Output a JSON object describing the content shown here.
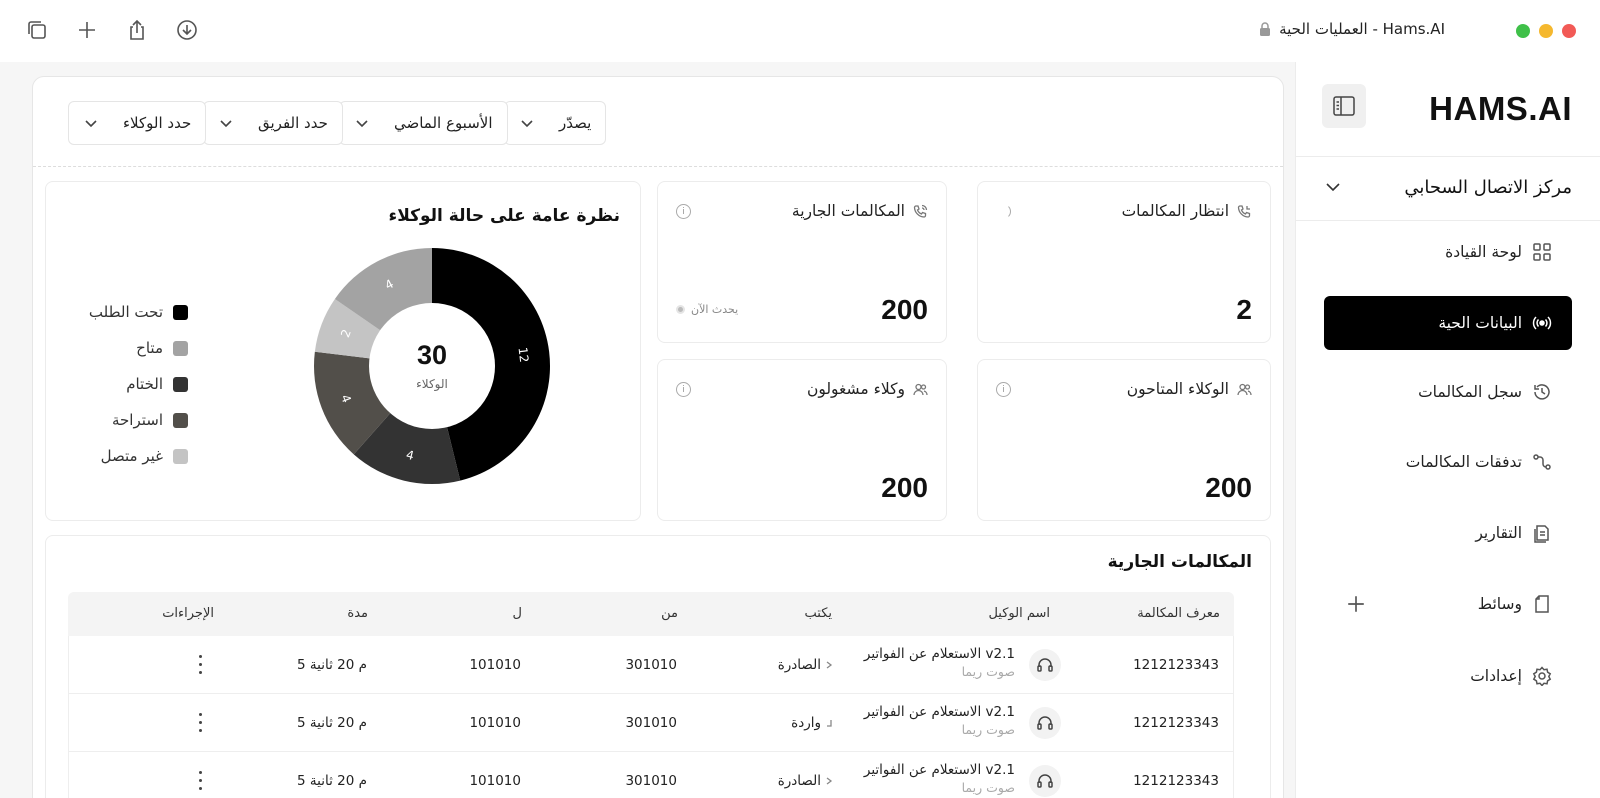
{
  "window": {
    "title": "العمليات الحية - Hams.AI"
  },
  "sidebar": {
    "logo": "HAMS.AI",
    "workspace": "مركز الاتصال السحابي",
    "items": [
      {
        "label": "لوحة القيادة",
        "icon": "grid-icon"
      },
      {
        "label": "البيانات الحية",
        "icon": "broadcast-icon",
        "active": true
      },
      {
        "label": "سجل المكالمات",
        "icon": "history-icon"
      },
      {
        "label": "تدفقات المكالمات",
        "icon": "flow-icon"
      },
      {
        "label": "التقارير",
        "icon": "reports-icon"
      },
      {
        "label": "وسائط",
        "icon": "media-icon"
      },
      {
        "label": "إعدادات",
        "icon": "gear-icon"
      }
    ]
  },
  "filters": {
    "export": "يصدّر",
    "period": "الأسبوع الماضي",
    "team": "حدد الفريق",
    "agents": "حدد الوكلاء"
  },
  "stats": {
    "waiting": {
      "title": "انتظار المكالمات",
      "value": "2"
    },
    "ongoing": {
      "title": "المكالمات الجارية",
      "value": "200",
      "live": "يحدث الآن"
    },
    "available": {
      "title": "الوكلاء المتاحون",
      "value": "200"
    },
    "busy": {
      "title": "وكلاء مشغولون",
      "value": "200"
    }
  },
  "chart_data": {
    "type": "pie",
    "title": "نظرة عامة على حالة الوكلاء",
    "center_value": "30",
    "center_label": "الوكلاء",
    "slices": [
      {
        "name": "تحت الطلب",
        "value": 12,
        "color": "#000000"
      },
      {
        "name": "الختام",
        "value": 4,
        "color": "#333333"
      },
      {
        "name": "استراحة",
        "value": 4,
        "color": "#524f4a"
      },
      {
        "name": "غير متصل",
        "value": 2,
        "color": "#c4c4c4"
      },
      {
        "name": "متاح",
        "value": 4,
        "color": "#a3a3a3"
      }
    ],
    "legend": [
      {
        "name": "تحت الطلب",
        "color": "#000000"
      },
      {
        "name": "متاح",
        "color": "#a3a3a3"
      },
      {
        "name": "الختام",
        "color": "#333333"
      },
      {
        "name": "استراحة",
        "color": "#524f4a"
      },
      {
        "name": "غير متصل",
        "color": "#c4c4c4"
      }
    ]
  },
  "table": {
    "title": "المكالمات الجارية",
    "headers": {
      "id": "معرف المكالمة",
      "agent": "اسم الوكيل",
      "type": "يكتب",
      "from": "من",
      "to": "ل",
      "duration": "مدة",
      "actions": "الإجراءات"
    },
    "rows": [
      {
        "id": "1212123343",
        "agent": "الاستعلام عن الفواتير v2.1",
        "agent_sub": "صوت ريما",
        "type": "الصادرة",
        "from": "301010",
        "to": "101010",
        "duration": "5 م 20 ثانية"
      },
      {
        "id": "1212123343",
        "agent": "الاستعلام عن الفواتير v2.1",
        "agent_sub": "صوت ريما",
        "type": "واردة",
        "from": "301010",
        "to": "101010",
        "duration": "5 م 20 ثانية"
      },
      {
        "id": "1212123343",
        "agent": "الاستعلام عن الفواتير v2.1",
        "agent_sub": "صوت ريما",
        "type": "الصادرة",
        "from": "301010",
        "to": "101010",
        "duration": "5 م 20 ثانية"
      }
    ]
  }
}
